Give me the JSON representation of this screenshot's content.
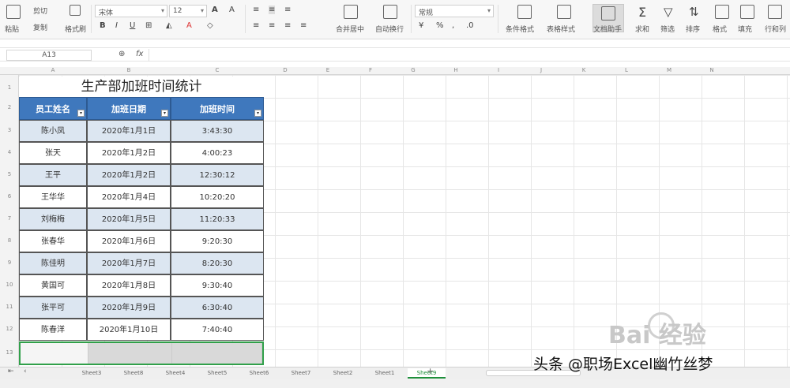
{
  "ribbon": {
    "paste": "粘贴",
    "cut": "剪切",
    "copy": "复制",
    "format_painter": "格式刷",
    "font_name": "宋体",
    "font_size": "12",
    "number_format": "常规",
    "merge_center": "合并居中",
    "wrap_text": "自动换行",
    "conditional_format": "条件格式",
    "table_style": "表格样式",
    "doc_helper": "文档助手",
    "sum": "求和",
    "filter": "筛选",
    "sort": "排序",
    "format": "格式",
    "fill": "填充",
    "row_col": "行和列"
  },
  "formula_bar": {
    "cell_ref": "A13",
    "fx": "fx",
    "value": ""
  },
  "columns": [
    "A",
    "B",
    "C",
    "D",
    "E",
    "F",
    "G",
    "H",
    "I",
    "J",
    "K",
    "L",
    "M",
    "N"
  ],
  "rows": [
    "1",
    "2",
    "3",
    "4",
    "5",
    "6",
    "7",
    "8",
    "9",
    "10",
    "11",
    "12",
    "13"
  ],
  "table": {
    "title": "生产部加班时间统计",
    "headers": [
      "员工姓名",
      "加班日期",
      "加班时间"
    ],
    "filter_glyph": "▾",
    "rows": [
      [
        "陈小凤",
        "2020年1月1日",
        "3:43:30"
      ],
      [
        "张天",
        "2020年1月2日",
        "4:00:23"
      ],
      [
        "王平",
        "2020年1月2日",
        "12:30:12"
      ],
      [
        "王华华",
        "2020年1月4日",
        "10:20:20"
      ],
      [
        "刘梅梅",
        "2020年1月5日",
        "11:20:33"
      ],
      [
        "张春华",
        "2020年1月6日",
        "9:20:30"
      ],
      [
        "陈佳明",
        "2020年1月7日",
        "8:20:30"
      ],
      [
        "黄国可",
        "2020年1月8日",
        "9:30:40"
      ],
      [
        "张平可",
        "2020年1月9日",
        "6:30:40"
      ],
      [
        "陈春洋",
        "2020年1月10日",
        "7:40:40"
      ]
    ]
  },
  "sheets": [
    "Sheet3",
    "Sheet8",
    "Sheet4",
    "Sheet5",
    "Sheet6",
    "Sheet7",
    "Sheet2",
    "Sheet1",
    "Sheet9"
  ],
  "active_sheet": "Sheet9",
  "add_sheet": "+",
  "watermark": "头条 @职场Excel幽竹丝梦",
  "baidu_logo": "Bai 经验",
  "colors": {
    "header_bg": "#3f78bd",
    "odd_row": "#dce6f1",
    "active_tab": "#1e8f3b"
  }
}
